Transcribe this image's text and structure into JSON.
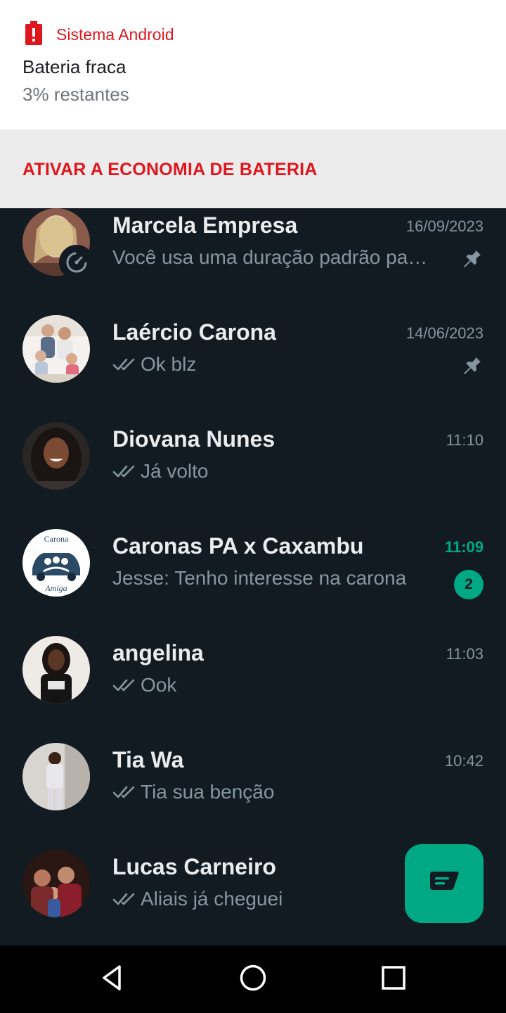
{
  "notification": {
    "app_name": "Sistema Android",
    "title": "Bateria fraca",
    "body": "3% restantes",
    "action_label": "ATIVAR A ECONOMIA DE BATERIA",
    "accent_color": "#e0161e"
  },
  "chats": [
    {
      "name": "Marcela Empresa",
      "time": "16/09/2023",
      "preview": "Você usa uma duração padrão pa…",
      "pinned": true,
      "ticks": false,
      "timer": true
    },
    {
      "name": "Laércio Carona",
      "time": "14/06/2023",
      "preview": "Ok blz",
      "pinned": true,
      "ticks": true
    },
    {
      "name": "Diovana Nunes",
      "time": "11:10",
      "preview": "Já volto",
      "ticks": true
    },
    {
      "name": "Caronas PA x Caxambu",
      "time": "11:09",
      "preview": "Jesse: Tenho interesse na carona",
      "unread_count": "2",
      "unread": true
    },
    {
      "name": "angelina",
      "time": "11:03",
      "preview": "Ook",
      "ticks": true
    },
    {
      "name": "Tia Wa",
      "time": "10:42",
      "preview": "Tia sua benção",
      "ticks": true
    },
    {
      "name": "Lucas Carneiro",
      "time": "",
      "preview": "Aliais já cheguei",
      "ticks": true
    }
  ],
  "group_avatar_text": {
    "top": "Carona",
    "bottom": "Amiga"
  },
  "icons": {
    "notification": "battery-alert-icon",
    "pin": "pin-icon",
    "read": "double-check-icon",
    "fab": "new-chat-icon",
    "nav": [
      "back-icon",
      "home-icon",
      "recents-icon"
    ]
  },
  "colors": {
    "background": "#121b22",
    "accent": "#00a884",
    "primary_text": "#e9edef",
    "secondary_text": "#8696a0"
  }
}
